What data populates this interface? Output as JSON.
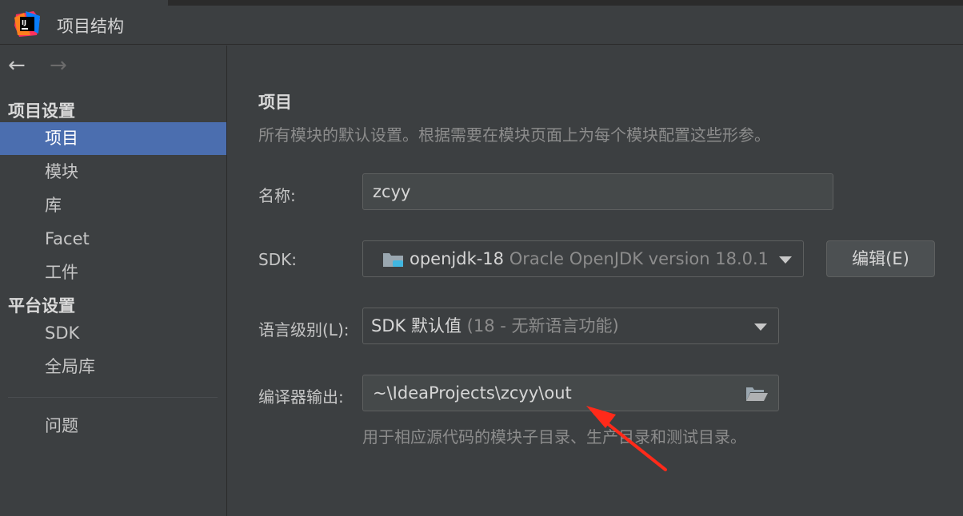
{
  "window": {
    "title": "项目结构",
    "logo_text": "IJ",
    "icon": "intellij-logo-icon"
  },
  "sidebar": {
    "back_glyph": "←",
    "forward_glyph": "→",
    "project_settings_header": "项目设置",
    "platform_settings_header": "平台设置",
    "items": [
      {
        "label": "项目",
        "selected": true
      },
      {
        "label": "模块"
      },
      {
        "label": "库"
      },
      {
        "label": "Facet"
      },
      {
        "label": "工件"
      },
      {
        "label": "SDK"
      },
      {
        "label": "全局库"
      },
      {
        "label": "问题"
      }
    ]
  },
  "main": {
    "heading": "项目",
    "description": "所有模块的默认设置。根据需要在模块页面上为每个模块配置这些形参。",
    "name_label": "名称:",
    "name_value": "zcyy",
    "sdk_label": "SDK:",
    "sdk_name": "openjdk-18",
    "sdk_detail": "Oracle OpenJDK version 18.0.1",
    "edit_button": "编辑(E)",
    "language_label": "语言级别(L):",
    "language_value": "SDK 默认值",
    "language_detail": "(18 - 无新语言功能)",
    "output_label": "编译器输出:",
    "output_value": "~\\IdeaProjects\\zcyy\\out",
    "output_hint": "用于相应源代码的模块子目录、生产目录和测试目录。"
  },
  "colors": {
    "background": "#3c3f41",
    "selection": "#4b6eaf",
    "annotation_arrow": "#ff2a1a"
  }
}
